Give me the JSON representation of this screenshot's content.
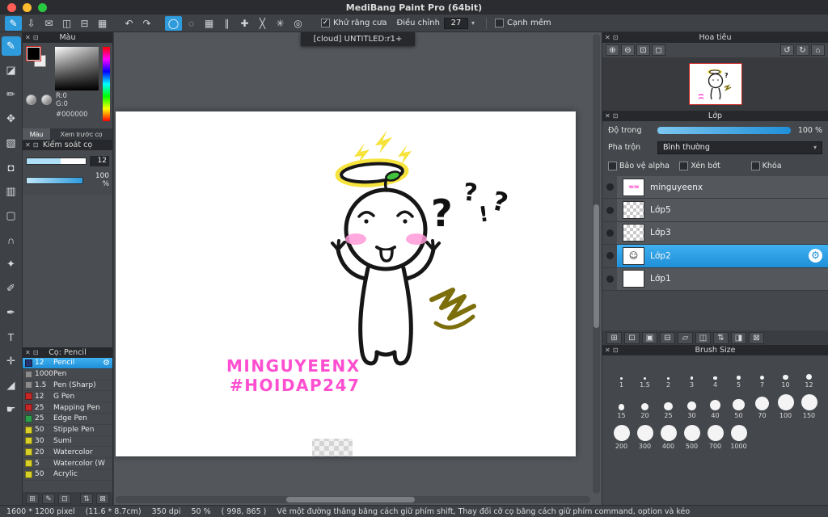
{
  "chrome": {
    "close": "✕",
    "collapse": "⊡",
    "check": "✓",
    "dropdown": "▾",
    "gear": "⚙"
  },
  "window": {
    "title": "MediBang Paint Pro (64bit)"
  },
  "toolbar": {
    "group1": [
      {
        "name": "brush-mode",
        "glyph": "✎",
        "selected": true
      },
      {
        "name": "save",
        "glyph": "⇩"
      },
      {
        "name": "comment",
        "glyph": "✉"
      },
      {
        "name": "panel-layout",
        "glyph": "◫"
      },
      {
        "name": "panel-rows",
        "glyph": "⊟"
      },
      {
        "name": "material",
        "glyph": "▦"
      }
    ],
    "group2": [
      {
        "name": "undo",
        "glyph": "↶"
      },
      {
        "name": "redo",
        "glyph": "↷"
      }
    ],
    "group3": [
      {
        "name": "snap-off",
        "glyph": "◯",
        "selected": true
      },
      {
        "name": "snap-ellipse",
        "glyph": "◌"
      },
      {
        "name": "snap-grid",
        "glyph": "▦"
      },
      {
        "name": "snap-parallel",
        "glyph": "∥"
      },
      {
        "name": "snap-cross",
        "glyph": "✚"
      },
      {
        "name": "snap-x",
        "glyph": "╳"
      },
      {
        "name": "snap-radial",
        "glyph": "✳"
      },
      {
        "name": "snap-concentric",
        "glyph": "◎"
      }
    ],
    "antialias": "Khử răng cưa",
    "adjust_label": "Điều chỉnh",
    "adjust_value": "27",
    "soft_edge": "Cạnh mềm"
  },
  "tools": {
    "items": [
      {
        "name": "brush",
        "glyph": "✎",
        "selected": true
      },
      {
        "name": "eraser",
        "glyph": "◪"
      },
      {
        "name": "dot",
        "glyph": "✏"
      },
      {
        "name": "move",
        "glyph": "✥"
      },
      {
        "name": "fill",
        "glyph": "▧"
      },
      {
        "name": "bucket",
        "glyph": "◘"
      },
      {
        "name": "gradient",
        "glyph": "▥"
      },
      {
        "name": "select",
        "glyph": "▢"
      },
      {
        "name": "lasso",
        "glyph": "∩"
      },
      {
        "name": "magic-wand",
        "glyph": "✦"
      },
      {
        "name": "select-pen",
        "glyph": "✐"
      },
      {
        "name": "select-eraser",
        "glyph": "✒"
      },
      {
        "name": "text",
        "glyph": "T"
      },
      {
        "name": "operation",
        "glyph": "✛"
      },
      {
        "name": "eyedropper",
        "glyph": "◢"
      },
      {
        "name": "hand",
        "glyph": "☛"
      }
    ]
  },
  "color_panel": {
    "title": "Màu",
    "r": "R:0",
    "g": "G:0",
    "hex": "#000000",
    "tab_color": "Màu",
    "tab_preview": "Xem trước cọ",
    "buttons": [
      {
        "name": "color-wheel",
        "glyph": "◐"
      },
      {
        "name": "palette",
        "glyph": "◑"
      }
    ]
  },
  "brush_control": {
    "title": "Kiểm soát cọ",
    "size_value": "12",
    "opacity_value": "100 %"
  },
  "brush_panel": {
    "title": "Cọ: Pencil",
    "brushes": [
      {
        "name": "Pencil",
        "size": "12",
        "chip": "#27346e",
        "selected": true
      },
      {
        "name": "Pen",
        "size": "1000",
        "chip": "#8b8b8b"
      },
      {
        "name": "Pen (Sharp)",
        "size": "1.5",
        "chip": "#8b8b8b"
      },
      {
        "name": "G Pen",
        "size": "12",
        "chip": "#c62828"
      },
      {
        "name": "Mapping Pen",
        "size": "25",
        "chip": "#c62828"
      },
      {
        "name": "Edge Pen",
        "size": "25",
        "chip": "#2e9e4b"
      },
      {
        "name": "Stipple Pen",
        "size": "50",
        "chip": "#d9cf2a"
      },
      {
        "name": "Sumi",
        "size": "30",
        "chip": "#d9cf2a"
      },
      {
        "name": "Watercolor",
        "size": "20",
        "chip": "#d9cf2a"
      },
      {
        "name": "Watercolor (W",
        "size": "5",
        "chip": "#d9cf2a"
      },
      {
        "name": "Acrylic",
        "size": "50",
        "chip": "#d9cf2a"
      }
    ],
    "toolbar": [
      {
        "name": "add-brush",
        "glyph": "⊞"
      },
      {
        "name": "edit-brush",
        "glyph": "✎"
      },
      {
        "name": "clone-brush",
        "glyph": "⊡"
      },
      {
        "name": "sort-brush",
        "glyph": "⇅"
      },
      {
        "name": "delete-brush",
        "glyph": "⊠"
      }
    ]
  },
  "canvas": {
    "tab": "[cloud] UNTITLED:r1+",
    "signature_line1": "MINGUYEENX",
    "signature_line2": "#HOIDAP247"
  },
  "navigator": {
    "title": "Hoa tiêu",
    "buttons": [
      {
        "name": "zoom-in",
        "glyph": "⊕"
      },
      {
        "name": "zoom-out",
        "glyph": "⊖"
      },
      {
        "name": "fit-screen",
        "glyph": "⊡"
      },
      {
        "name": "actual-size",
        "glyph": "◻"
      },
      {
        "name": "rotate-left",
        "glyph": "↺"
      },
      {
        "name": "rotate-right",
        "glyph": "↻"
      },
      {
        "name": "reset-view",
        "glyph": "⌂"
      }
    ]
  },
  "layers": {
    "title": "Lớp",
    "opacity_label": "Độ trong",
    "opacity_value": "100 %",
    "blend_label": "Pha trộn",
    "blend_value": "Bình thường",
    "checkboxes": [
      {
        "name": "protect-alpha",
        "label": "Bảo vệ alpha"
      },
      {
        "name": "clipping",
        "label": "Xén bớt"
      },
      {
        "name": "lock",
        "label": "Khóa"
      }
    ],
    "items": [
      {
        "name": "minguyeenx",
        "thumb": "pink"
      },
      {
        "name": "Lớp5",
        "thumb": "checker"
      },
      {
        "name": "Lớp3",
        "thumb": "checker"
      },
      {
        "name": "Lớp2",
        "thumb": "art",
        "selected": true
      },
      {
        "name": "Lớp1",
        "thumb": "white"
      }
    ],
    "toolbar": [
      {
        "name": "add-layer",
        "glyph": "⊞"
      },
      {
        "name": "duplicate-layer",
        "glyph": "⊡"
      },
      {
        "name": "layer-settings",
        "glyph": "▣"
      },
      {
        "name": "merge-down",
        "glyph": "⊟"
      },
      {
        "name": "add-folder",
        "glyph": "▱"
      },
      {
        "name": "clipping-toggle",
        "glyph": "◫"
      },
      {
        "name": "reorder-layer",
        "glyph": "⇅"
      },
      {
        "name": "import-image",
        "glyph": "◨"
      },
      {
        "name": "delete-layer",
        "glyph": "⊠"
      }
    ]
  },
  "brush_size": {
    "title": "Brush Size",
    "sizes": [
      "1",
      "1.5",
      "2",
      "3",
      "4",
      "5",
      "7",
      "10",
      "12",
      "15",
      "20",
      "25",
      "30",
      "40",
      "50",
      "70",
      "100",
      "150",
      "200",
      "300",
      "400",
      "500",
      "700",
      "1000"
    ]
  },
  "status": {
    "dimensions": "1600 * 1200 pixel",
    "physical": "(11.6 * 8.7cm)",
    "dpi": "350 dpi",
    "zoom": "50 %",
    "coords": "( 998, 865 )",
    "hint": "Vẽ một đường thẳng bằng cách giữ phím shift, Thay đổi cỡ cọ bằng cách giữ phím command, option và kéo"
  }
}
